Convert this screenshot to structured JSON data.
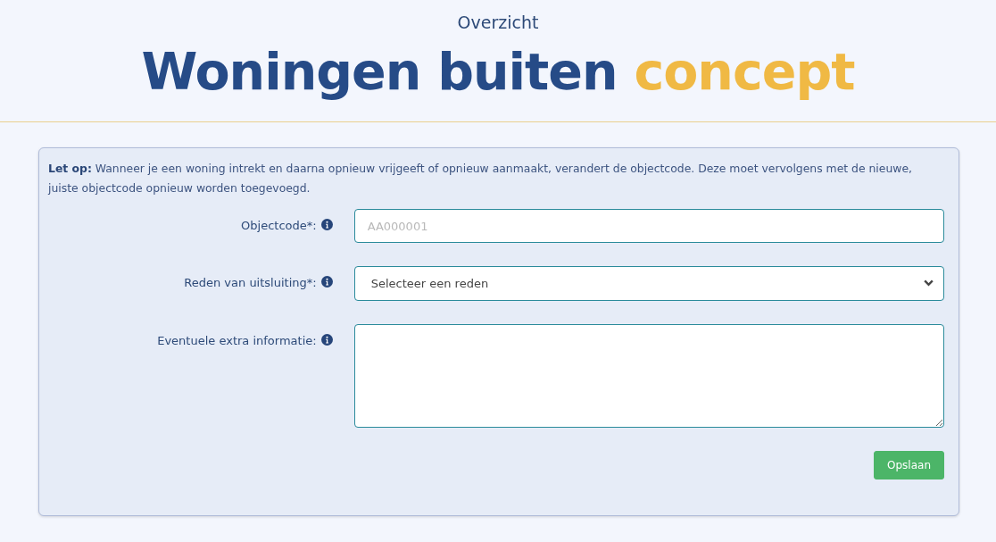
{
  "header": {
    "subtitle": "Overzicht",
    "title": "Woningen buiten",
    "title_accent": "concept"
  },
  "notice": "**Let op:** Wanneer je een woning intrekt en daarna opnieuw vrijgeeft of opnieuw aanmaakt, verandert de objectcode. Deze moet vervolgens met de nieuwe, juiste objectcode opnieuw worden toegevoegd.",
  "fields": [
    {
      "kind": "input",
      "label": "Objectcode*:",
      "placeholder": "AA000001"
    },
    {
      "kind": "select",
      "label": "Reden van uitsluiting*:",
      "value": "Selecteer een reden"
    },
    {
      "kind": "textarea",
      "label": "Eventuele extra informatie:"
    }
  ],
  "buttons": [
    "Opslaan"
  ]
}
